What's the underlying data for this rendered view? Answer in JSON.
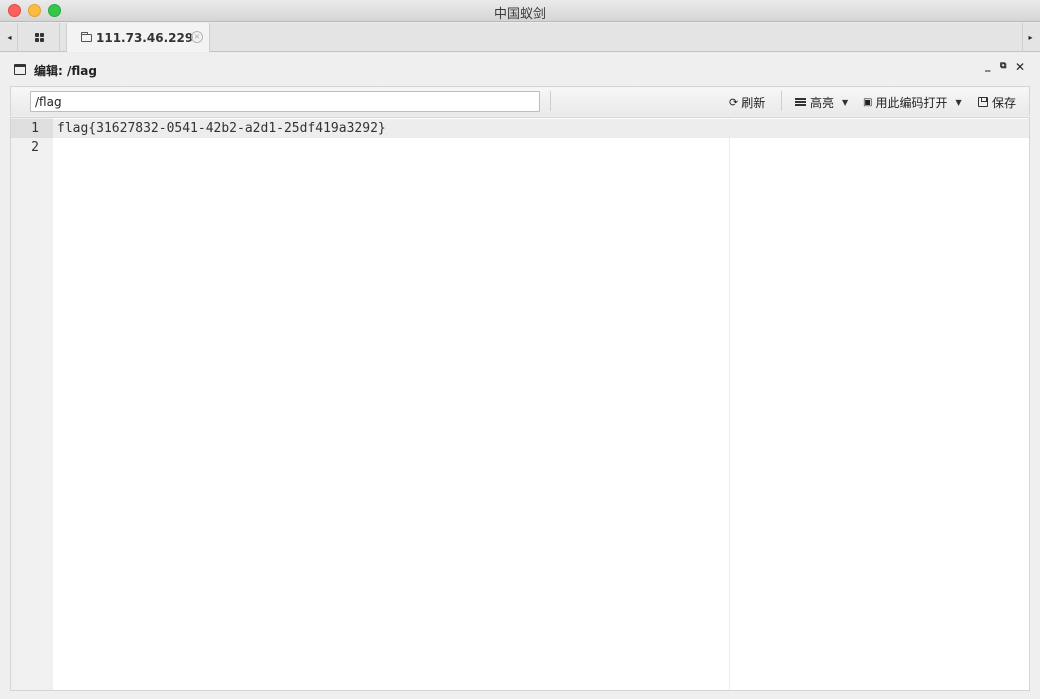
{
  "window": {
    "title": "中国蚁剑"
  },
  "tabs": {
    "scroll_left": "◂",
    "scroll_right": "▸",
    "host_tab_label": "111.73.46.229",
    "host_tab_close": "×"
  },
  "editor_panel": {
    "title": "编辑: /flag",
    "controls": {
      "minimize": "_",
      "restore": "⧉",
      "close": "✕"
    }
  },
  "toolbar": {
    "path_value": "/flag",
    "refresh_icon": "⟳",
    "refresh_label": "刷新",
    "highlight_label": "高亮",
    "encoding_label": "用此编码打开",
    "save_label": "保存",
    "dropdown_caret": "▼"
  },
  "document": {
    "lines": [
      {
        "number": "1",
        "text": "flag{31627832-0541-42b2-a2d1-25df419a3292}"
      },
      {
        "number": "2",
        "text": ""
      }
    ]
  }
}
